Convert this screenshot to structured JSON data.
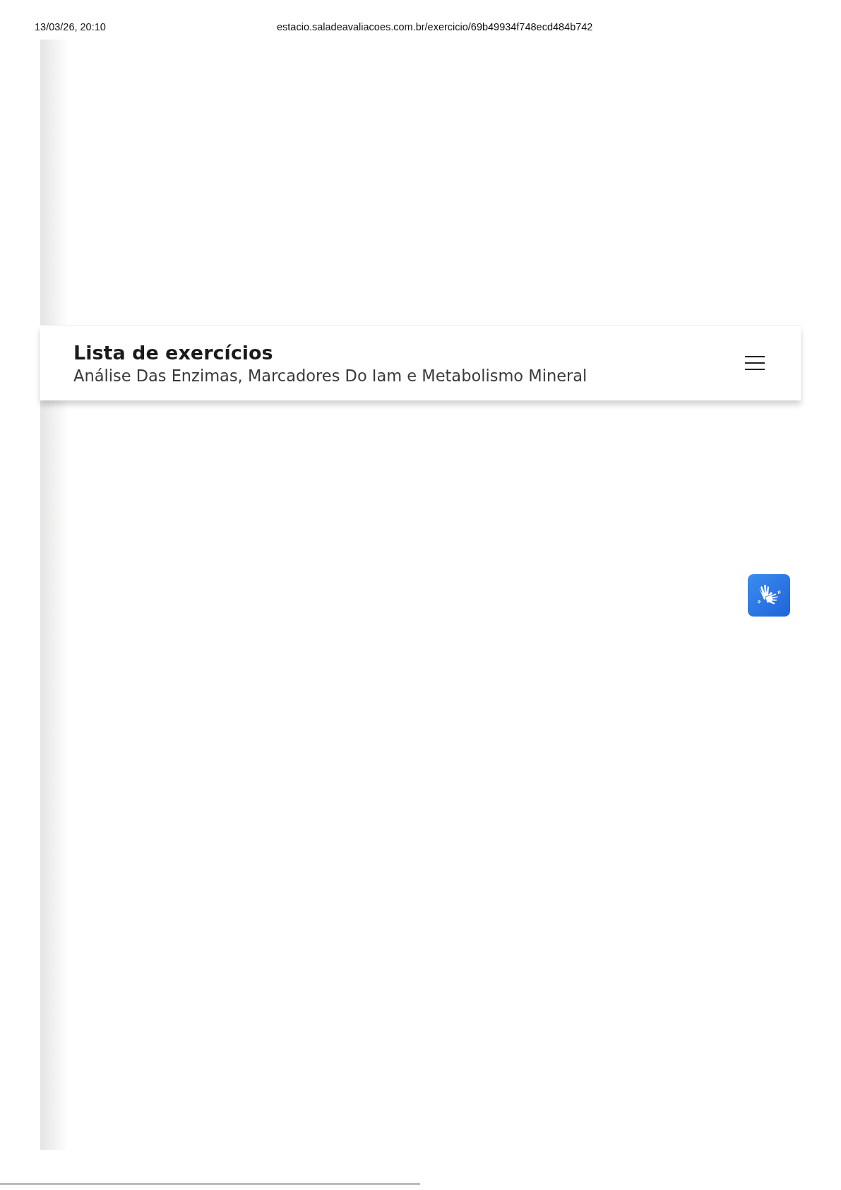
{
  "print_header": {
    "date": "13/03/26, 20:10",
    "url": "estacio.saladeavaliacoes.com.br/exercicio/69b49934f748ecd484b742"
  },
  "header": {
    "title": "Lista de exercícios",
    "subtitle": "Análise Das Enzimas, Marcadores Do Iam e Metabolismo Mineral"
  }
}
